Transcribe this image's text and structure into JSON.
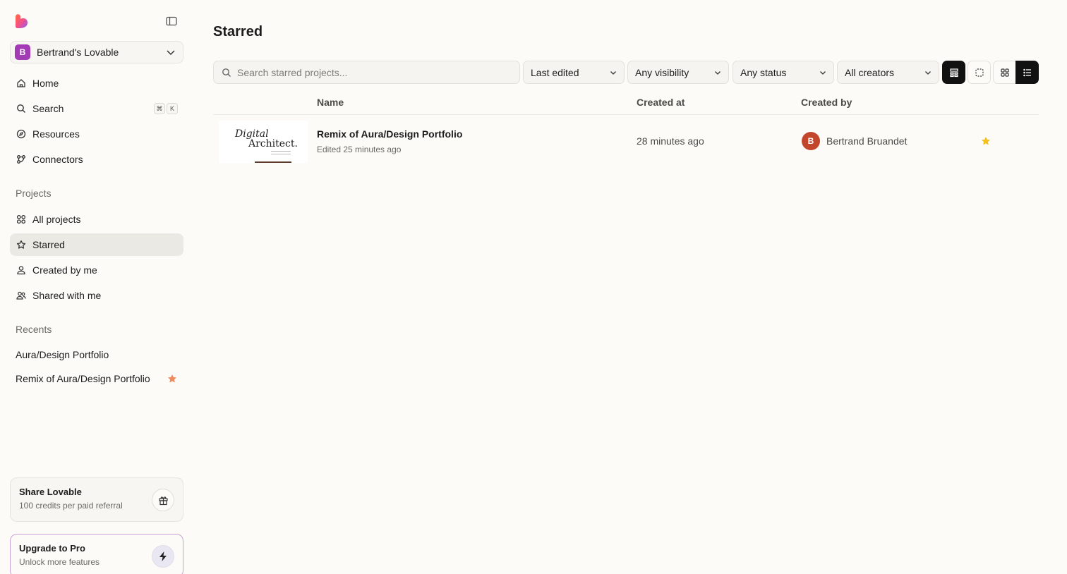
{
  "sidebar": {
    "workspace": {
      "initial": "B",
      "name": "Bertrand's Lovable"
    },
    "nav": [
      {
        "label": "Home",
        "icon": "home-icon"
      },
      {
        "label": "Search",
        "icon": "search-icon",
        "shortcut": [
          "⌘",
          "K"
        ]
      },
      {
        "label": "Resources",
        "icon": "compass-icon"
      },
      {
        "label": "Connectors",
        "icon": "connectors-icon"
      }
    ],
    "projects_label": "Projects",
    "projects": [
      {
        "label": "All projects",
        "icon": "grid-icon"
      },
      {
        "label": "Starred",
        "icon": "star-icon",
        "active": true
      },
      {
        "label": "Created by me",
        "icon": "user-icon"
      },
      {
        "label": "Shared with me",
        "icon": "users-icon"
      }
    ],
    "recents_label": "Recents",
    "recents": [
      {
        "label": "Aura/Design Portfolio",
        "starred": false
      },
      {
        "label": "Remix of Aura/Design Portfolio",
        "starred": true
      }
    ],
    "share_card": {
      "title": "Share Lovable",
      "subtitle": "100 credits per paid referral",
      "icon": "gift-icon"
    },
    "upgrade_card": {
      "title": "Upgrade to Pro",
      "subtitle": "Unlock more features",
      "icon": "lightning-icon"
    }
  },
  "main": {
    "title": "Starred",
    "search_placeholder": "Search starred projects...",
    "filters": {
      "sort": "Last edited",
      "visibility": "Any visibility",
      "status": "Any status",
      "creators": "All creators"
    },
    "view_buttons": [
      "board-view-icon",
      "select-icon",
      "grid-view-icon",
      "list-view-icon"
    ],
    "columns": {
      "name": "Name",
      "created_at": "Created at",
      "created_by": "Created by"
    },
    "rows": [
      {
        "name": "Remix of Aura/Design Portfolio",
        "edited": "Edited 25 minutes ago",
        "created_at": "28 minutes ago",
        "creator_initial": "B",
        "creator": "Bertrand Bruandet",
        "starred": true,
        "thumb_line1": "Digital",
        "thumb_line2": "Architect."
      }
    ]
  },
  "colors": {
    "background": "#fcfbf8",
    "workspace_avatar": "#a23bb5",
    "creator_avatar": "#c2462c",
    "star_row": "#f2c21b",
    "star_recent": "#f08a5d",
    "active_nav": "#ebe9e4"
  }
}
